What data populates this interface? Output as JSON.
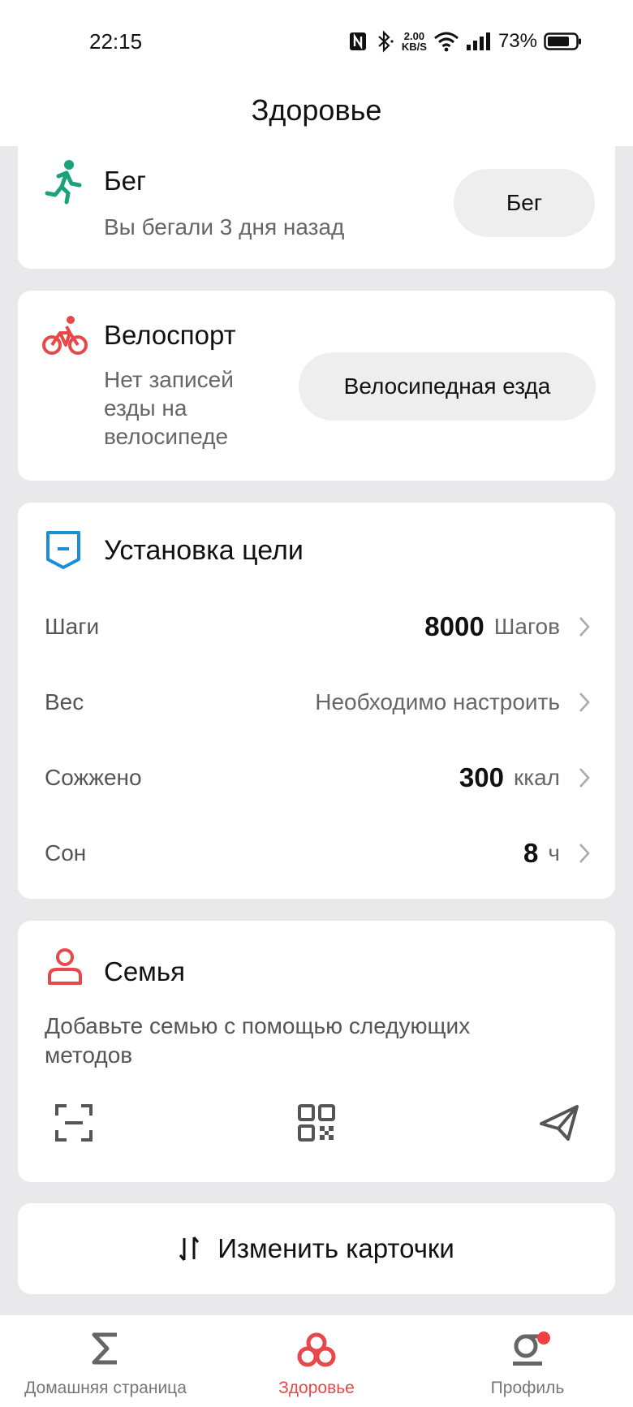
{
  "status_bar": {
    "time": "22:15",
    "net_speed_value": "2.00",
    "net_speed_unit": "KB/S",
    "battery_percent": "73%"
  },
  "header": {
    "title": "Здоровье"
  },
  "run_card": {
    "title": "Бег",
    "subtitle": "Вы бегали 3 дня назад",
    "button_label": "Бег",
    "icon": "running-person-icon",
    "accent": "#1aa37a"
  },
  "bike_card": {
    "title": "Велоспорт",
    "subtitle": "Нет записей езды на велосипеде",
    "button_label": "Велосипедная езда",
    "icon": "cyclist-icon",
    "accent": "#e8484a"
  },
  "goal_card": {
    "title": "Установка цели",
    "icon": "goal-flag-icon",
    "accent": "#1a8fd6",
    "rows": [
      {
        "label": "Шаги",
        "value": "8000",
        "unit": "Шагов"
      },
      {
        "label": "Вес",
        "value": "",
        "unit": "Необходимо настроить"
      },
      {
        "label": "Сожжено",
        "value": "300",
        "unit": "ккал"
      },
      {
        "label": "Сон",
        "value": "8",
        "unit": "ч"
      }
    ]
  },
  "family_card": {
    "title": "Семья",
    "description": "Добавьте семью с помощью следующих методов",
    "icon": "person-icon",
    "accent": "#e8484a",
    "actions": [
      "scan-icon",
      "qr-code-icon",
      "send-icon"
    ]
  },
  "edit_cards": {
    "label": "Изменить карточки",
    "icon": "sort-arrows-icon"
  },
  "nav": {
    "items": [
      {
        "label": "Домашняя страница",
        "icon": "sigma-icon",
        "active": false
      },
      {
        "label": "Здоровье",
        "icon": "health-icon",
        "active": true
      },
      {
        "label": "Профиль",
        "icon": "profile-icon",
        "active": false
      }
    ],
    "active_color": "#e8484a",
    "badge_color": "#f04040"
  }
}
